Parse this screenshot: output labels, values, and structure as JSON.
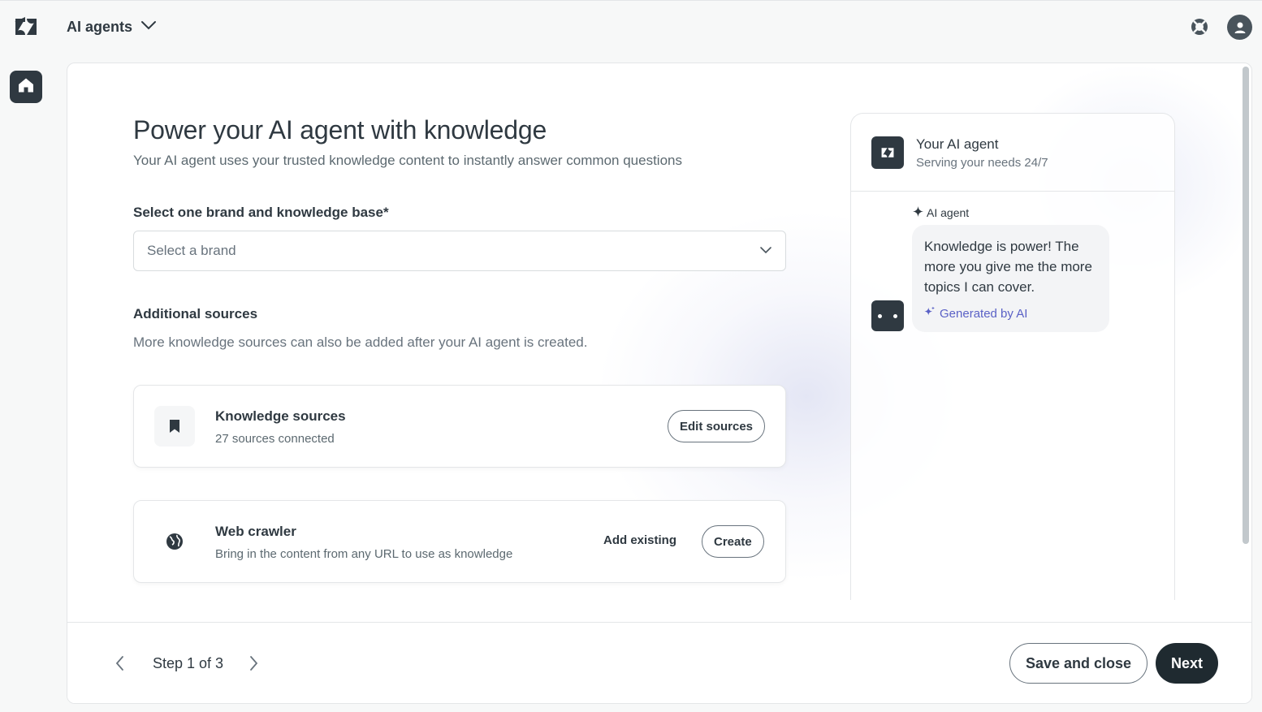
{
  "topbar": {
    "product_name": "AI agents",
    "icons": {
      "logo": "zendesk-logo-icon",
      "switcher": "chevron-down-icon",
      "help": "help-lifebuoy-icon",
      "profile": "user-avatar-icon"
    }
  },
  "sidebar": {
    "home_icon": "home-icon"
  },
  "main": {
    "title": "Power your AI agent with knowledge",
    "subtitle": "Your AI agent uses your trusted knowledge content to instantly answer common questions",
    "brand_field": {
      "label": "Select one brand and knowledge base*",
      "placeholder": "Select a brand"
    },
    "additional": {
      "heading": "Additional sources",
      "description": "More knowledge sources can also be added after your AI agent is created."
    },
    "knowledge_card": {
      "title": "Knowledge sources",
      "description": "27 sources connected",
      "button": "Edit sources",
      "icon": "bookmark-icon"
    },
    "crawler_card": {
      "title": "Web crawler",
      "description": "Bring in the content from any URL to use as knowledge",
      "add_existing": "Add existing",
      "create": "Create",
      "icon": "globe-icon"
    }
  },
  "preview": {
    "agent_name": "Your AI agent",
    "agent_tagline": "Serving your needs 24/7",
    "sender": "AI agent",
    "message": "Knowledge is power! The more you give me the more topics I can cover.",
    "generated_label": "Generated by AI"
  },
  "footer": {
    "step_label": "Step 1 of 3",
    "save_close": "Save and close",
    "next": "Next"
  },
  "colors": {
    "text_primary": "#2f3941",
    "accent_ai": "#5a61c6",
    "primary_button": "#1f2a30"
  }
}
